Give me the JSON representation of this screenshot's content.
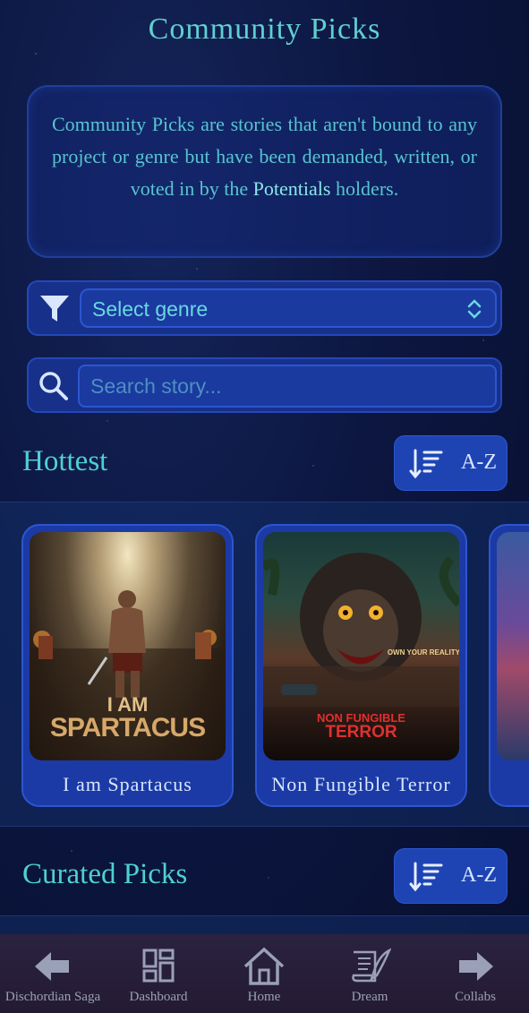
{
  "header": {
    "title": "Community Picks"
  },
  "info": {
    "text_before": "Community Picks are stories that aren't bound to any project or genre but have been demanded, written, or voted in by the ",
    "highlight": "Potentials",
    "text_after": " holders."
  },
  "filter": {
    "selected": "Select genre",
    "icon": "filter-icon"
  },
  "search": {
    "placeholder": "Search story...",
    "value": ""
  },
  "sections": {
    "hottest": {
      "title": "Hottest",
      "sort_label": "A-Z"
    },
    "curated": {
      "title": "Curated Picks",
      "sort_label": "A-Z"
    }
  },
  "hottest_cards": [
    {
      "title": "I am Spartacus",
      "cover_line1": "I AM",
      "cover_line2": "SPARTACUS"
    },
    {
      "title": "Non Fungible Terror",
      "cover_line1": "NON FUNGIBLE",
      "cover_line2": "TERROR",
      "tagline": "OWN YOUR REALITY"
    },
    {
      "title": ""
    }
  ],
  "nav": [
    {
      "label": "Dischordian Saga",
      "icon": "arrow-left-icon"
    },
    {
      "label": "Dashboard",
      "icon": "dashboard-icon"
    },
    {
      "label": "Home",
      "icon": "home-icon"
    },
    {
      "label": "Dream",
      "icon": "scroll-quill-icon"
    },
    {
      "label": "Collabs",
      "icon": "arrow-right-icon"
    }
  ],
  "colors": {
    "accent": "#5fd0d0",
    "panel": "#17308a",
    "button": "#1e44b4",
    "nav_bg": "#2a2240"
  }
}
